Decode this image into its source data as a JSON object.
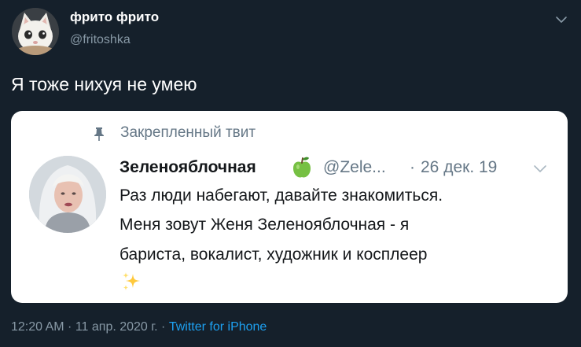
{
  "tweet": {
    "author": {
      "display_name": "фрито фрито",
      "handle": "@fritoshka",
      "avatar_icon": "white-cat-avatar"
    },
    "text": "Я тоже нихуя не умею",
    "quoted": {
      "pinned_label": "Закрепленный твит",
      "author_name": "Зеленояблочная",
      "author_handle": "@Zele...",
      "separator": "·",
      "date": "26 дек. 19",
      "lines": [
        "Раз люди набегают, давайте знакомиться.",
        "Меня зовут Женя Зеленояблочная - я",
        "бариста, вокалист, художник и косплеер"
      ],
      "emoji_icon": "sparkles-icon"
    },
    "meta": {
      "time": "12:20 AM",
      "sep1": " · ",
      "date": "11 апр. 2020 г.",
      "sep2": " · ",
      "source": "Twitter for iPhone"
    }
  },
  "colors": {
    "background": "#15202b",
    "secondary_text": "#8899a6",
    "link": "#1da1f2",
    "card": "#ffffff"
  }
}
